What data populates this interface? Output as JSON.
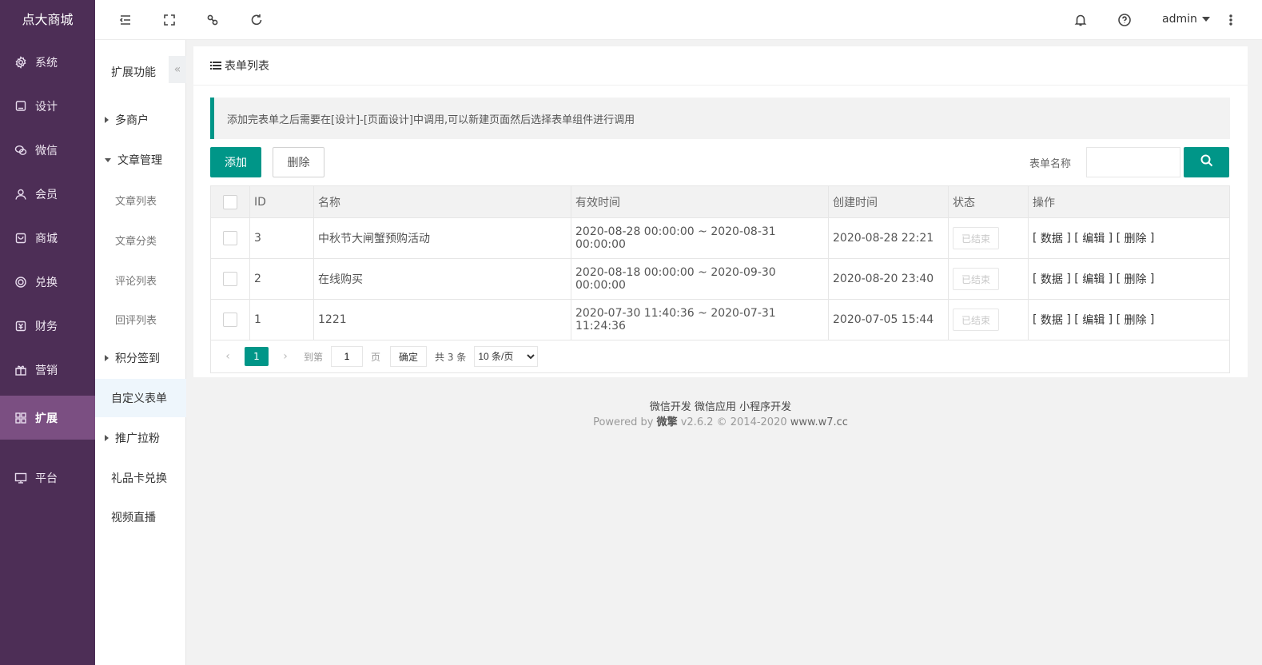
{
  "brand": "点大商城",
  "sidebar": {
    "items": [
      {
        "label": "系统",
        "icon": "gear-icon"
      },
      {
        "label": "设计",
        "icon": "design-icon"
      },
      {
        "label": "微信",
        "icon": "wechat-icon"
      },
      {
        "label": "会员",
        "icon": "user-icon"
      },
      {
        "label": "商城",
        "icon": "shop-icon"
      },
      {
        "label": "兑换",
        "icon": "exchange-icon"
      },
      {
        "label": "财务",
        "icon": "finance-icon"
      },
      {
        "label": "营销",
        "icon": "gift-icon"
      },
      {
        "label": "扩展",
        "icon": "grid-icon",
        "active": true
      },
      {
        "label": "平台",
        "icon": "monitor-icon"
      }
    ]
  },
  "subnav": {
    "title": "扩展功能",
    "collapse": "«",
    "items": [
      {
        "label": "多商户"
      },
      {
        "label": "文章管理"
      },
      {
        "label": "文章列表"
      },
      {
        "label": "文章分类"
      },
      {
        "label": "评论列表"
      },
      {
        "label": "回评列表"
      },
      {
        "label": "积分签到"
      },
      {
        "label": "自定义表单"
      },
      {
        "label": "推广拉粉"
      },
      {
        "label": "礼品卡兑换"
      },
      {
        "label": "视频直播"
      }
    ]
  },
  "header": {
    "user": "admin",
    "icons": [
      "menu-fold-icon",
      "fullscreen-icon",
      "link-icon",
      "refresh-icon",
      "bell-icon",
      "help-icon",
      "more-icon"
    ]
  },
  "card": {
    "title": "表单列表",
    "notice": "添加完表单之后需要在[设计]-[页面设计]中调用,可以新建页面然后选择表单组件进行调用",
    "add_label": "添加",
    "delete_label": "删除",
    "search_label": "表单名称",
    "search_value": ""
  },
  "table": {
    "columns": [
      "ID",
      "名称",
      "有效时间",
      "创建时间",
      "状态",
      "操作"
    ],
    "rows": [
      {
        "id": "3",
        "name": "中秋节大闸蟹预购活动",
        "valid": "2020-08-28 00:00:00 ~ 2020-08-31 00:00:00",
        "created": "2020-08-28 22:21",
        "status": "已结束"
      },
      {
        "id": "2",
        "name": "在线购买",
        "valid": "2020-08-18 00:00:00 ~ 2020-09-30 00:00:00",
        "created": "2020-08-20 23:40",
        "status": "已结束"
      },
      {
        "id": "1",
        "name": "1221",
        "valid": "2020-07-30 11:40:36 ~ 2020-07-31 11:24:36",
        "created": "2020-07-05 15:44",
        "status": "已结束"
      }
    ],
    "ops": {
      "data": "数据",
      "edit": "编辑",
      "delete": "删除"
    }
  },
  "pager": {
    "prev": "‹",
    "next": "›",
    "current": "1",
    "goto_label": "到第",
    "page_value": "1",
    "page_unit": "页",
    "confirm": "确定",
    "total": "共 3 条",
    "per_page": "10 条/页"
  },
  "footer": {
    "links": [
      "微信开发",
      "微信应用",
      "小程序开发"
    ],
    "powered_prefix": "Powered by",
    "powered_brand": "微擎",
    "powered_version": "v2.6.2 © 2014-2020",
    "powered_site": "www.w7.cc"
  },
  "colors": {
    "sidebar_bg": "#4d2e56",
    "sidebar_active": "#7b4f82",
    "primary": "#009688"
  }
}
